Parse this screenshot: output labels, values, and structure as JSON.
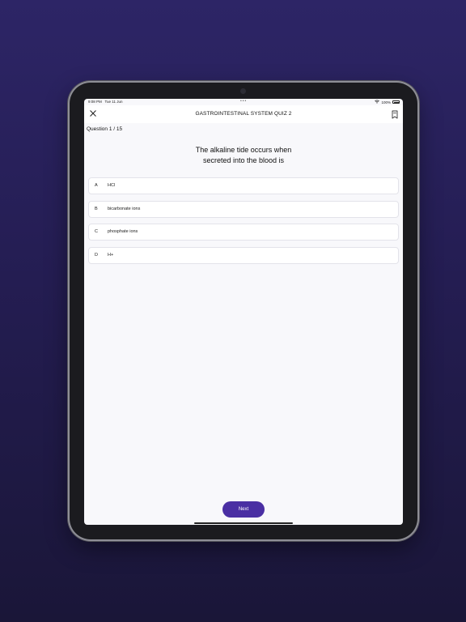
{
  "status_bar": {
    "time": "9:08 PM",
    "date": "Tue 11 Jun",
    "dots": "•••",
    "battery": "100%"
  },
  "nav": {
    "title": "GASTROINTESTINAL SYSTEM QUIZ 2",
    "close_icon": "close-icon",
    "bookmark_icon": "bookmark-icon"
  },
  "quiz": {
    "counter": "Question 1 / 15",
    "question": "The alkaline tide occurs when secreted into the blood is",
    "options": [
      {
        "letter": "A",
        "text": "HCl"
      },
      {
        "letter": "B",
        "text": "bicarbonate ions"
      },
      {
        "letter": "C",
        "text": "phosphate ions"
      },
      {
        "letter": "D",
        "text": "H+"
      }
    ],
    "next_label": "Next"
  },
  "colors": {
    "background": "#2d2566",
    "accent": "#4a2fa3",
    "screen": "#f8f8fb"
  }
}
